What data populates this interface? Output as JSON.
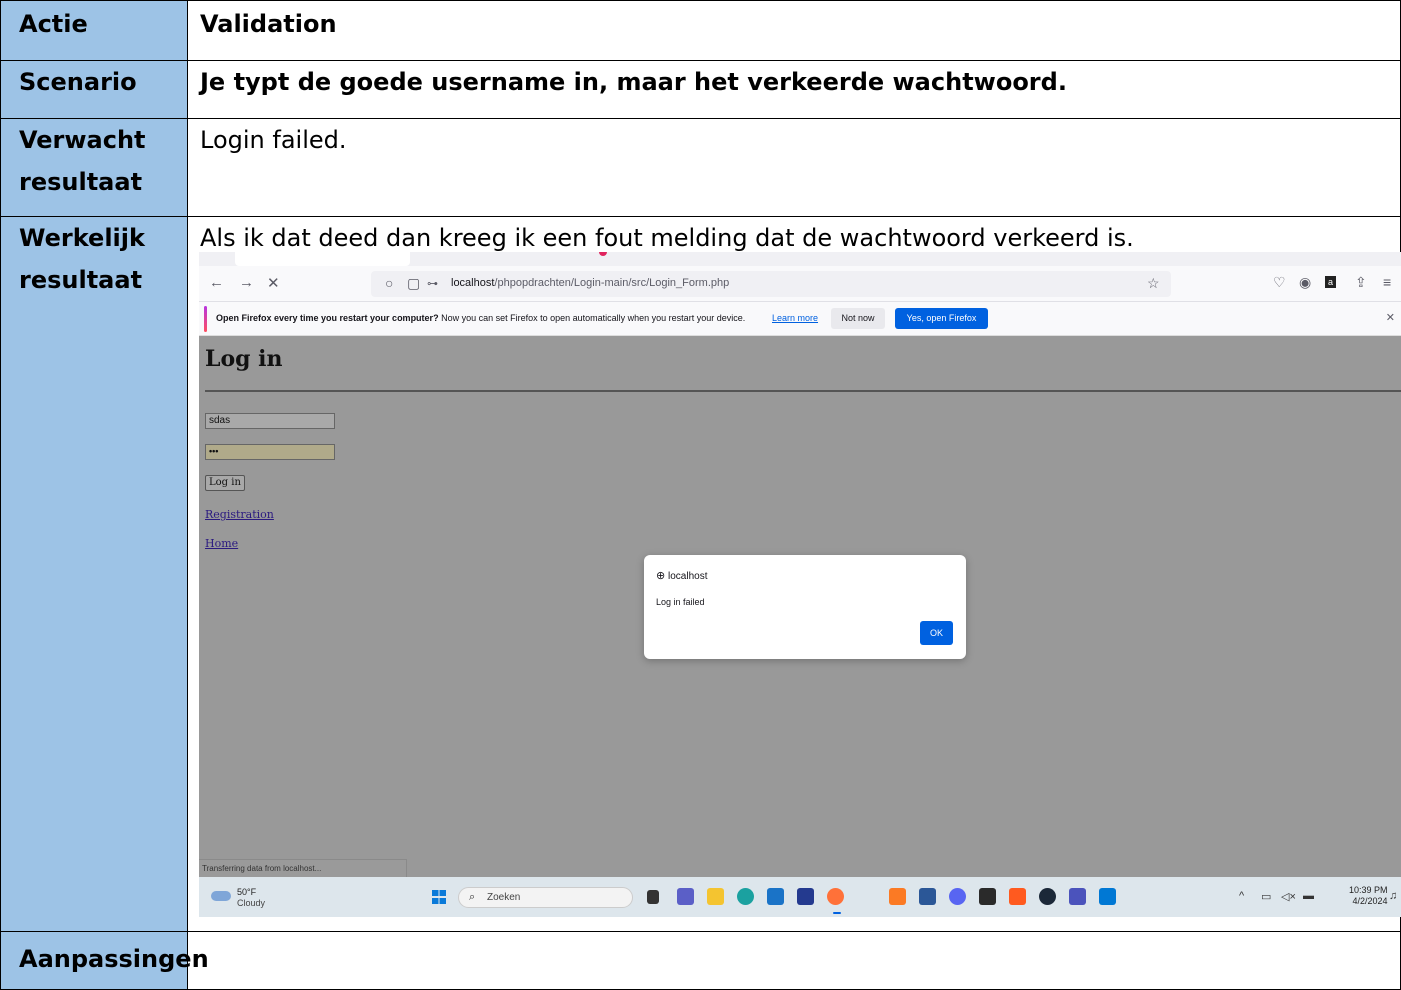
{
  "rows": [
    {
      "label": "Actie",
      "value": "Validation"
    },
    {
      "label": "Scenario",
      "value": "Je typt de goede username in, maar het verkeerde wachtwoord."
    },
    {
      "label_line1": "Verwacht",
      "label_line2": "resultaat",
      "value": "Login failed."
    },
    {
      "label_line1": "Werkelijk",
      "label_line2": "resultaat",
      "value": "Als ik dat deed dan kreeg ik een fout melding dat de wachtwoord verkeerd is."
    },
    {
      "label": "Aanpassingen",
      "value": ""
    }
  ],
  "colors": {
    "label_bg": "#9dc3e6",
    "firefox_blue": "#0061e0"
  },
  "browser": {
    "url_prefix": "localhost",
    "url_path": "/phpopdrachten/Login-main/src/Login_Form.php",
    "infobar": {
      "bold_text": "Open Firefox every time you restart your computer?",
      "text": " Now you can set Firefox to open automatically when you restart your device.",
      "learn_more": "Learn more",
      "not_now": "Not now",
      "yes_open": "Yes, open Firefox"
    },
    "status_text": "Transferring data from localhost..."
  },
  "login_page": {
    "title": "Log in",
    "username_value": "sdas",
    "password_value": "•••",
    "login_button": "Log in",
    "registration_link": "Registration",
    "home_link": "Home"
  },
  "dialog": {
    "origin": "localhost",
    "message": "Log in failed",
    "ok": "OK"
  },
  "taskbar": {
    "temperature": "50°F",
    "condition": "Cloudy",
    "search_placeholder": "Zoeken",
    "time": "10:39 PM",
    "date": "4/2/2024"
  }
}
